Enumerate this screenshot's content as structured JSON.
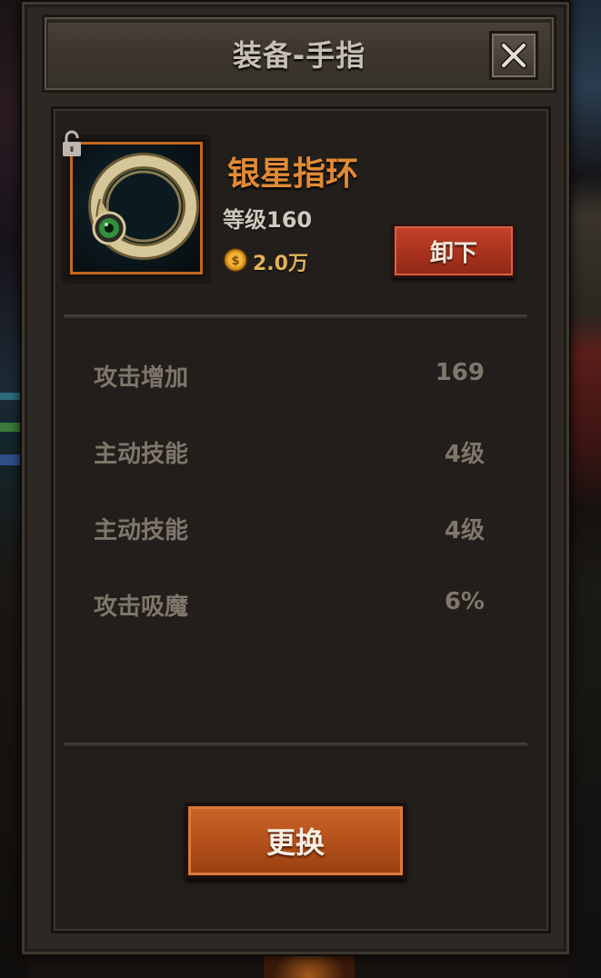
{
  "dialog": {
    "title": "装备-手指",
    "close_icon": "close-icon"
  },
  "item": {
    "name": "银星指环",
    "level": "等级160",
    "price": "2.0万",
    "icon": "ring-icon",
    "locked_icon": "lock-icon",
    "coin_icon": "coin-icon",
    "name_color": "#e18a35",
    "slot_border_color": "#c4681e"
  },
  "actions": {
    "unequip_label": "卸下",
    "replace_label": "更换"
  },
  "stats": [
    {
      "label": "攻击增加",
      "value": "169"
    },
    {
      "label": "主动技能",
      "value": "4级"
    },
    {
      "label": "主动技能",
      "value": "4级"
    },
    {
      "label": "攻击吸魔",
      "value": "6%"
    }
  ]
}
